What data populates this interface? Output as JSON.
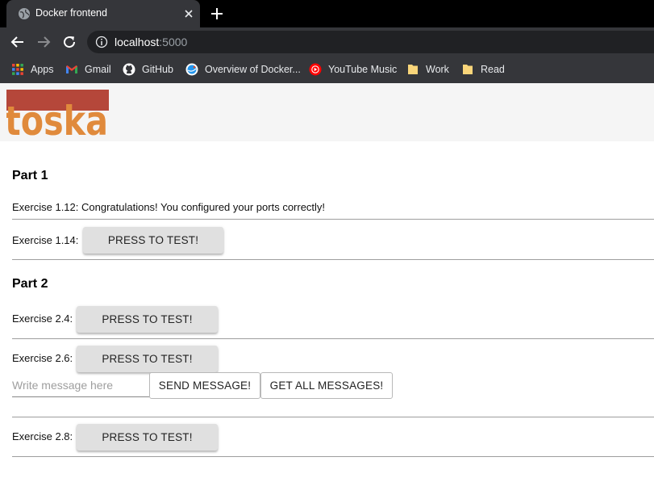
{
  "browser": {
    "tab_title": "Docker frontend",
    "url_host": "localhost",
    "url_port": ":5000",
    "bookmarks": [
      {
        "label": "Apps",
        "icon": "apps-grid-icon"
      },
      {
        "label": "Gmail",
        "icon": "gmail-icon"
      },
      {
        "label": "GitHub",
        "icon": "github-icon"
      },
      {
        "label": "Overview of Docker...",
        "icon": "docker-icon"
      },
      {
        "label": "YouTube Music",
        "icon": "youtube-music-icon"
      },
      {
        "label": "Work",
        "icon": "folder-icon"
      },
      {
        "label": "Read",
        "icon": "folder-icon"
      }
    ]
  },
  "header": {
    "logo_text": "toska",
    "logo_colors": {
      "top_bar": "#b5473a",
      "letters": "#e08a3c"
    }
  },
  "part1": {
    "title": "Part 1",
    "ex112_text": "Exercise 1.12: Congratulations! You configured your ports correctly!",
    "ex114_label": "Exercise 1.14:",
    "ex114_button": "PRESS TO TEST!"
  },
  "part2": {
    "title": "Part 2",
    "ex24_label": "Exercise 2.4:",
    "ex24_button": "PRESS TO TEST!",
    "ex26_label": "Exercise 2.6:",
    "ex26_button": "PRESS TO TEST!",
    "message_placeholder": "Write message here",
    "message_value": "",
    "send_button": "SEND MESSAGE!",
    "get_all_button": "GET ALL MESSAGES!",
    "ex28_label": "Exercise 2.8:",
    "ex28_button": "PRESS TO TEST!"
  },
  "colors": {
    "tabstrip": "#000000",
    "toolbar": "#35363a",
    "page_header_bg": "#f5f5f5",
    "button_bg": "#e0e0e0",
    "divider": "#9e9e9e"
  }
}
